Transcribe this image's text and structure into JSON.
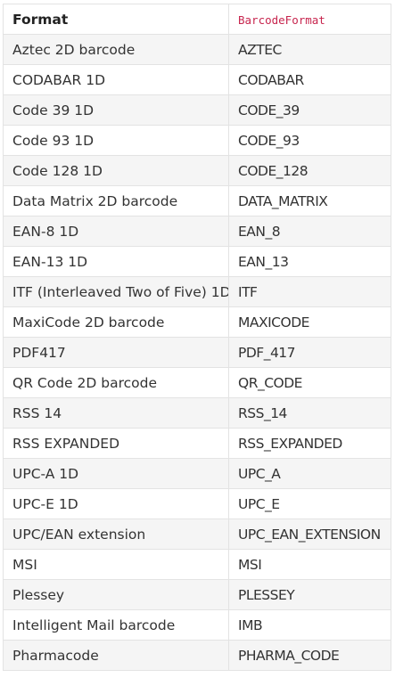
{
  "table": {
    "headers": {
      "format": "Format",
      "barcode_format": "BarcodeFormat"
    },
    "rows": [
      {
        "format": "Aztec 2D barcode",
        "enum": "AZTEC"
      },
      {
        "format": "CODABAR 1D",
        "enum": "CODABAR"
      },
      {
        "format": "Code 39 1D",
        "enum": "CODE_39"
      },
      {
        "format": "Code 93 1D",
        "enum": "CODE_93"
      },
      {
        "format": "Code 128 1D",
        "enum": "CODE_128"
      },
      {
        "format": "Data Matrix 2D barcode",
        "enum": "DATA_MATRIX"
      },
      {
        "format": "EAN-8 1D",
        "enum": "EAN_8"
      },
      {
        "format": "EAN-13 1D",
        "enum": "EAN_13"
      },
      {
        "format": "ITF (Interleaved Two of Five) 1D",
        "enum": "ITF"
      },
      {
        "format": "MaxiCode 2D barcode",
        "enum": "MAXICODE"
      },
      {
        "format": "PDF417",
        "enum": "PDF_417"
      },
      {
        "format": "QR Code 2D barcode",
        "enum": "QR_CODE"
      },
      {
        "format": "RSS 14",
        "enum": "RSS_14"
      },
      {
        "format": "RSS EXPANDED",
        "enum": "RSS_EXPANDED"
      },
      {
        "format": "UPC-A 1D",
        "enum": "UPC_A"
      },
      {
        "format": "UPC-E 1D",
        "enum": "UPC_E"
      },
      {
        "format": "UPC/EAN extension",
        "enum": "UPC_EAN_EXTENSION"
      },
      {
        "format": "MSI",
        "enum": "MSI"
      },
      {
        "format": "Plessey",
        "enum": "PLESSEY"
      },
      {
        "format": "Intelligent Mail barcode",
        "enum": "IMB"
      },
      {
        "format": "Pharmacode",
        "enum": "PHARMA_CODE"
      }
    ]
  }
}
